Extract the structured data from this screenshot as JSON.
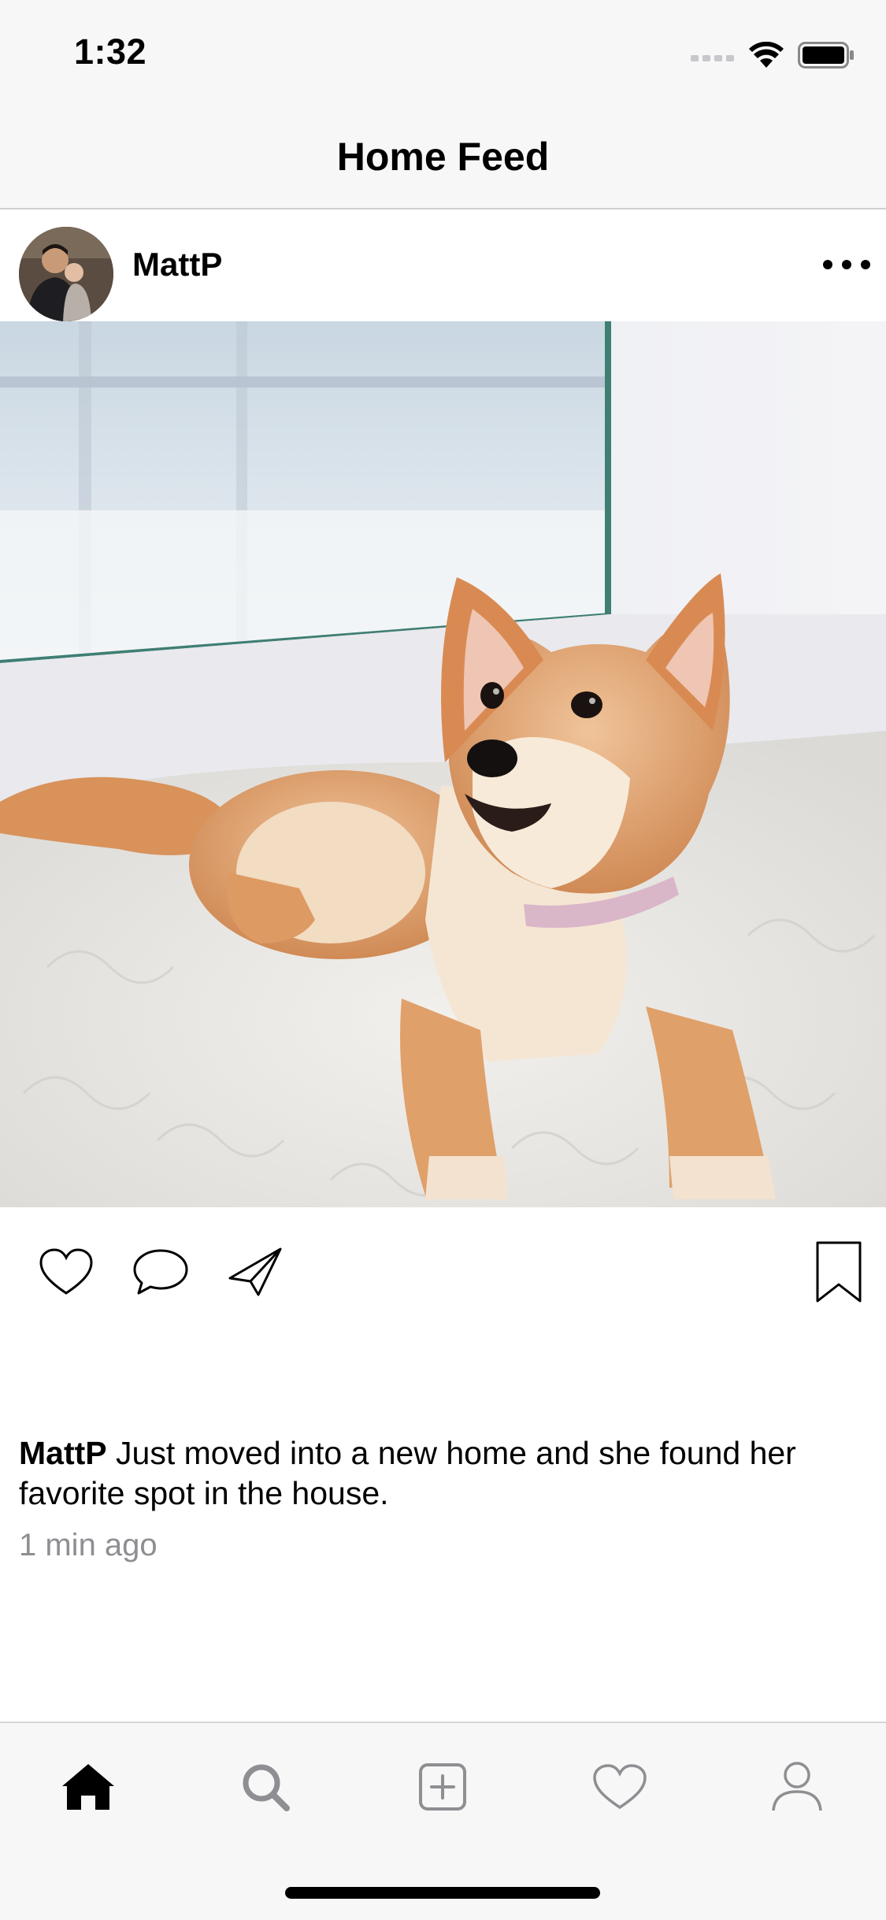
{
  "status_bar": {
    "time": "1:32"
  },
  "nav": {
    "title": "Home Feed"
  },
  "post": {
    "username": "MattP",
    "caption_user": "MattP",
    "caption_text": "Just moved into a new home and she found her favorite spot in the house.",
    "timestamp": "1 min ago",
    "photo_subject": "shiba inu puppy lying on white fur rug by window",
    "avatar_subject": "man holding baby"
  },
  "tabs": [
    {
      "name": "home",
      "icon": "home-icon",
      "active": true
    },
    {
      "name": "search",
      "icon": "search-icon",
      "active": false
    },
    {
      "name": "new-post",
      "icon": "plus-square-icon",
      "active": false
    },
    {
      "name": "activity",
      "icon": "heart-icon",
      "active": false
    },
    {
      "name": "profile",
      "icon": "person-icon",
      "active": false
    }
  ],
  "colors": {
    "bar_bg": "#f7f7f7",
    "inactive_icon": "#8e8e93",
    "timestamp": "#8e8e93",
    "active_icon": "#000000"
  }
}
